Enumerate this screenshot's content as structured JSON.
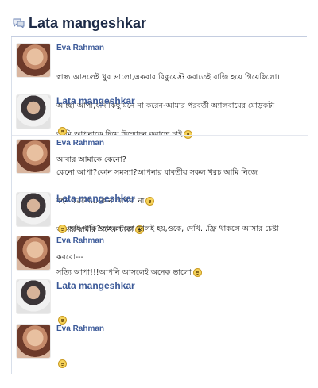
{
  "header": {
    "title": "Lata mangeshkar",
    "icon": "chat-bubbles-icon"
  },
  "messages": [
    {
      "sender": "Eva Rahman",
      "avatar": "eva-avatar",
      "lines": [
        "স্বাস্থ্য আসলেই খুব ভালো,একবার রিকুয়েস্ট করাতেই রাজি হয়ে গিয়েছিলো।",
        "আচ্ছা আপা,যদি কিছু মনে না করেন-আমার পরবর্তী অ্যালবামের মোড়কটা",
        "আমি আপনাকে দিয়ে উন্মোচন করাতে চাই"
      ],
      "trailing_emoticon": "embarrassed-icon"
    },
    {
      "sender": "Lata mangeshkar",
      "avatar": "lata-avatar",
      "lines": [
        "",
        "আবার আমাকে কেনো?"
      ],
      "leading_emoticon": "smile-icon"
    },
    {
      "sender": "Eva Rahman",
      "avatar": "eva-avatar",
      "lines": [
        "কেনো আপা?কোন সমস্যা?আপনার যাবতীয় সকল খরচ আমি নিজে",
        "বহন করবো...কোন ব্যাপার না",
        "আমার স্বামীর অনেক টাকা"
      ],
      "emoticons": [
        "smile-icon",
        "sunglasses-icon"
      ]
    },
    {
      "sender": "Lata mangeshkar",
      "avatar": "lata-avatar",
      "lines": [
        "তাই নাকি?তাহলে তো ভালই হয়,ওকে, দেখি...ফ্রি থাকলে আসার চেষ্টা",
        "করবো---"
      ],
      "leading_emoticon": "smile-icon"
    },
    {
      "sender": "Eva Rahman",
      "avatar": "eva-avatar",
      "lines": [
        "সত্যি আপা!!!আপনি আসলেই অনেক ভালো"
      ],
      "trailing_emoticon": "embarrassed-icon"
    },
    {
      "sender": "Lata mangeshkar",
      "avatar": "lata-avatar",
      "lines": [
        ""
      ],
      "leading_emoticon": "smile-icon"
    },
    {
      "sender": "Eva Rahman",
      "avatar": "eva-avatar",
      "lines": [
        ""
      ],
      "leading_emoticon": "embarrassed-icon"
    }
  ]
}
